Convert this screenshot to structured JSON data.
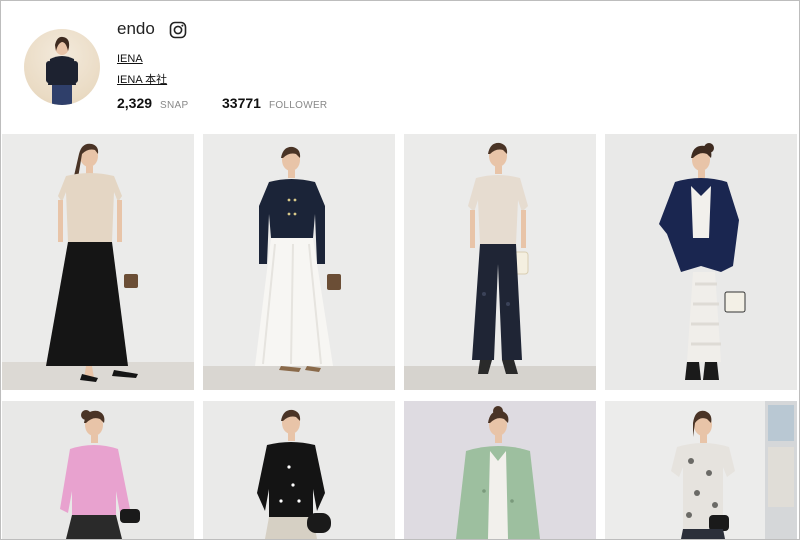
{
  "profile": {
    "username": "endo",
    "links": [
      "IENA",
      "IENA 本社"
    ],
    "stats": [
      {
        "value": "2,329",
        "label": "SNAP"
      },
      {
        "value": "33771",
        "label": "FOLLOWER"
      }
    ]
  },
  "snaps": [
    {
      "top": "sand-knit-top",
      "bottom": "black-maxi-skirt",
      "bag": "brown-handbag"
    },
    {
      "top": "navy-cardigan",
      "bottom": "white-maxi-skirt",
      "bag": "brown-handbag"
    },
    {
      "top": "beige-cardigan",
      "bottom": "navy-eyelet-pants",
      "bag": "cream-basket-bag"
    },
    {
      "top": "navy-parka",
      "bottom": "white-lace-skirt",
      "bag": "white-tote"
    },
    {
      "top": "pink-sweatshirt",
      "bottom": "black-skirt",
      "bag": "black-bag"
    },
    {
      "top": "black-cardigan",
      "bottom": "print-skirt",
      "bag": "black-bag"
    },
    {
      "top": "sage-shirt-jacket",
      "bottom": "",
      "bag": ""
    },
    {
      "top": "floral-blouse",
      "bottom": "",
      "bag": "black-bag"
    }
  ],
  "colors": {
    "wall": "#ececec",
    "wall_warm": "#e7e4df",
    "floor": "#d9d6d1",
    "skin": "#e8c4a8",
    "hair": "#4a3426"
  }
}
